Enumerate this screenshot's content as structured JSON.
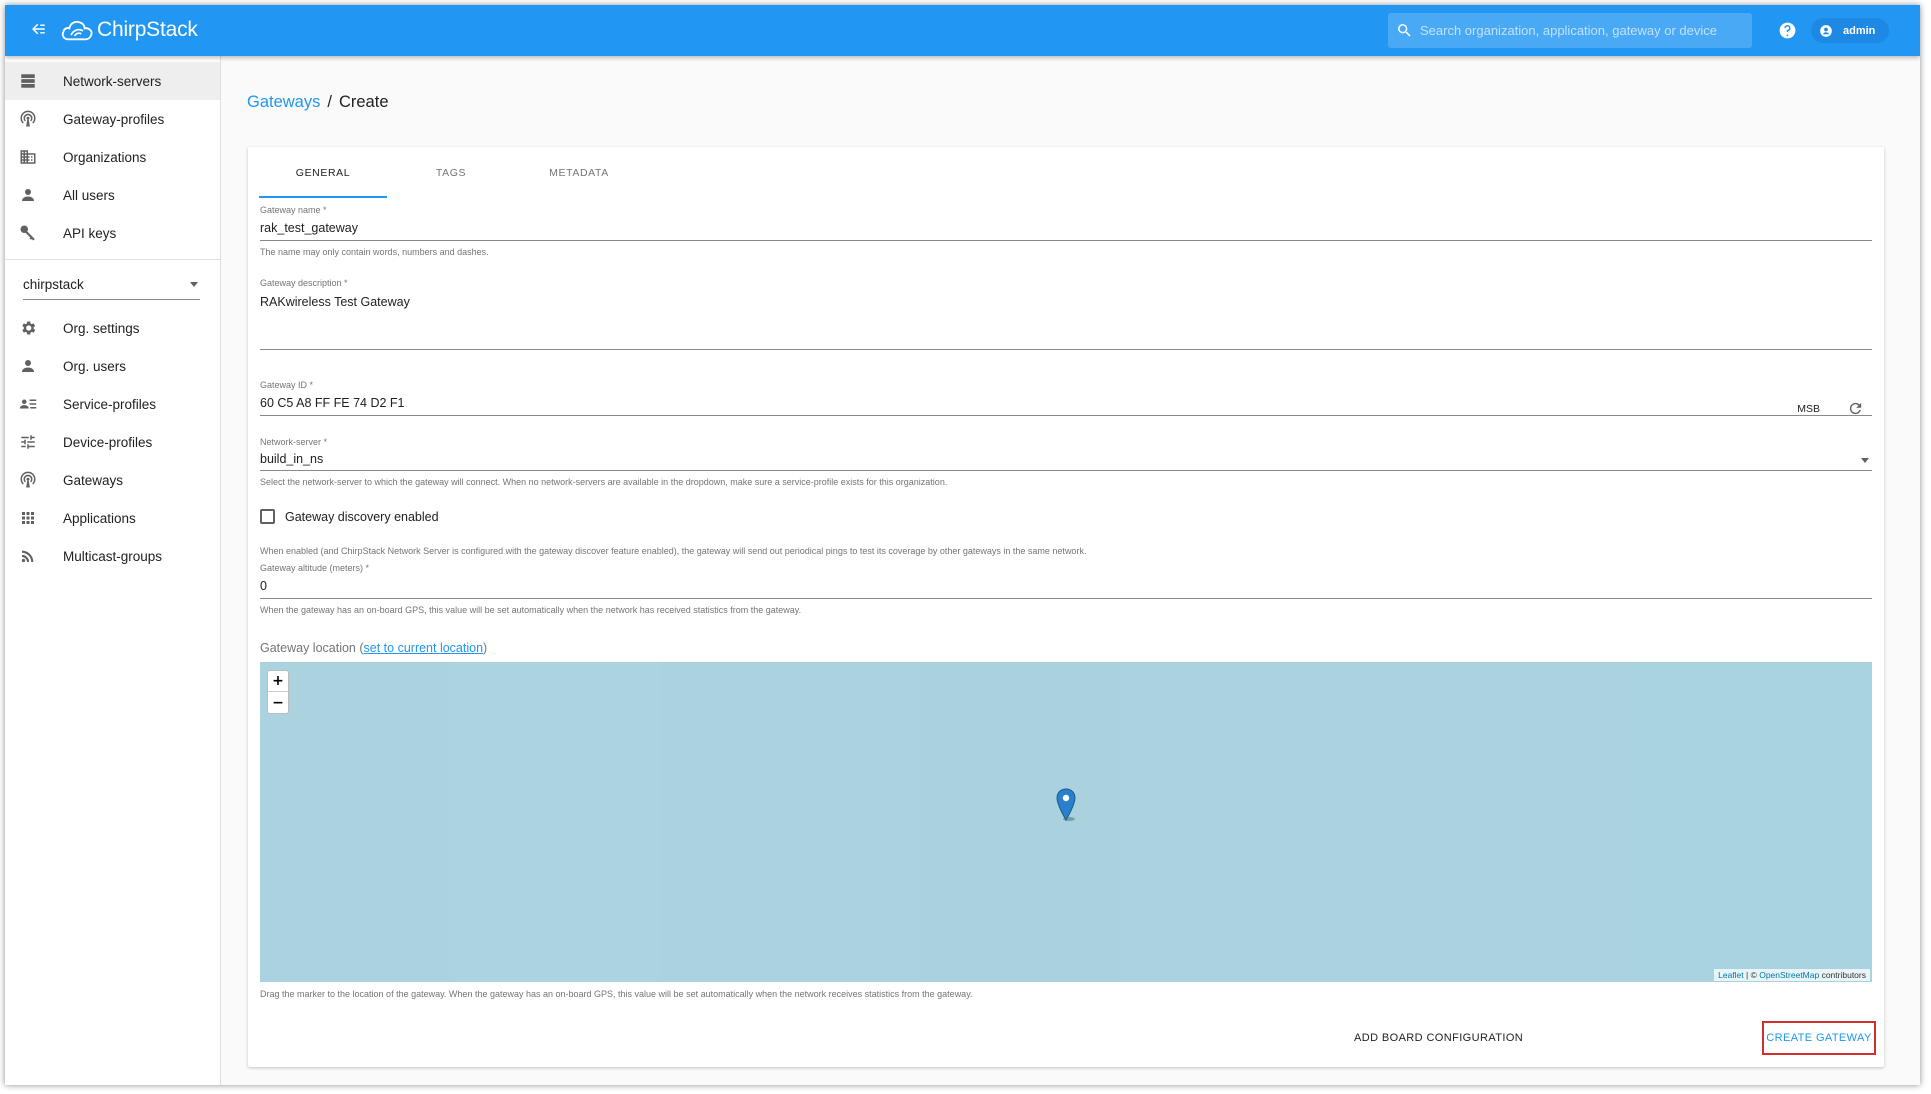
{
  "header": {
    "app_name": "ChirpStack",
    "search_placeholder": "Search organization, application, gateway or device",
    "user_name": "admin"
  },
  "sidebar": {
    "admin_items": [
      {
        "label": "Network-servers",
        "icon": "server-icon",
        "active": true
      },
      {
        "label": "Gateway-profiles",
        "icon": "radio-tower-icon"
      },
      {
        "label": "Organizations",
        "icon": "domain-icon"
      },
      {
        "label": "All users",
        "icon": "person-icon"
      },
      {
        "label": "API keys",
        "icon": "key-icon"
      }
    ],
    "org_selected": "chirpstack",
    "org_items": [
      {
        "label": "Org. settings",
        "icon": "gear-icon"
      },
      {
        "label": "Org. users",
        "icon": "person-icon"
      },
      {
        "label": "Service-profiles",
        "icon": "account-details-icon"
      },
      {
        "label": "Device-profiles",
        "icon": "tune-icon"
      },
      {
        "label": "Gateways",
        "icon": "radio-tower-icon"
      },
      {
        "label": "Applications",
        "icon": "apps-grid-icon"
      },
      {
        "label": "Multicast-groups",
        "icon": "rss-icon"
      }
    ]
  },
  "breadcrumb": {
    "parent": "Gateways",
    "separator": "/",
    "current": "Create"
  },
  "tabs": [
    {
      "label": "GENERAL",
      "active": true
    },
    {
      "label": "TAGS"
    },
    {
      "label": "METADATA"
    }
  ],
  "form": {
    "name": {
      "label": "Gateway name *",
      "value": "rak_test_gateway",
      "helper": "The name may only contain words, numbers and dashes."
    },
    "description": {
      "label": "Gateway description *",
      "value": "RAKwireless Test Gateway"
    },
    "gateway_id": {
      "label": "Gateway ID *",
      "value": "60 C5 A8 FF FE 74 D2 F1",
      "byte_order": "MSB"
    },
    "network_server": {
      "label": "Network-server *",
      "value": "build_in_ns",
      "helper": "Select the network-server to which the gateway will connect. When no network-servers are available in the dropdown, make sure a service-profile exists for this organization."
    },
    "discovery": {
      "label": "Gateway discovery enabled",
      "checked": false,
      "helper": "When enabled (and ChirpStack Network Server is configured with the gateway discover feature enabled), the gateway will send out periodical pings to test its coverage by other gateways in the same network."
    },
    "altitude": {
      "label": "Gateway altitude (meters) *",
      "value": "0",
      "helper": "When the gateway has an on-board GPS, this value will be set automatically when the network has received statistics from the gateway."
    },
    "location": {
      "label_prefix": "Gateway location (",
      "link_text": "set to current location",
      "label_suffix": ")",
      "map_zoom_in": "+",
      "map_zoom_out": "−",
      "attribution_leaflet": "Leaflet",
      "attribution_mid": " | © ",
      "attribution_osm": "OpenStreetMap",
      "attribution_tail": " contributors",
      "helper": "Drag the marker to the location of the gateway. When the gateway has an on-board GPS, this value will be set automatically when the network receives statistics from the gateway."
    }
  },
  "actions": {
    "add_board": "ADD BOARD CONFIGURATION",
    "create": "CREATE GATEWAY"
  },
  "colors": {
    "primary": "#2196f3",
    "highlight_box": "#d32f2f",
    "map_water": "#aad3df"
  }
}
